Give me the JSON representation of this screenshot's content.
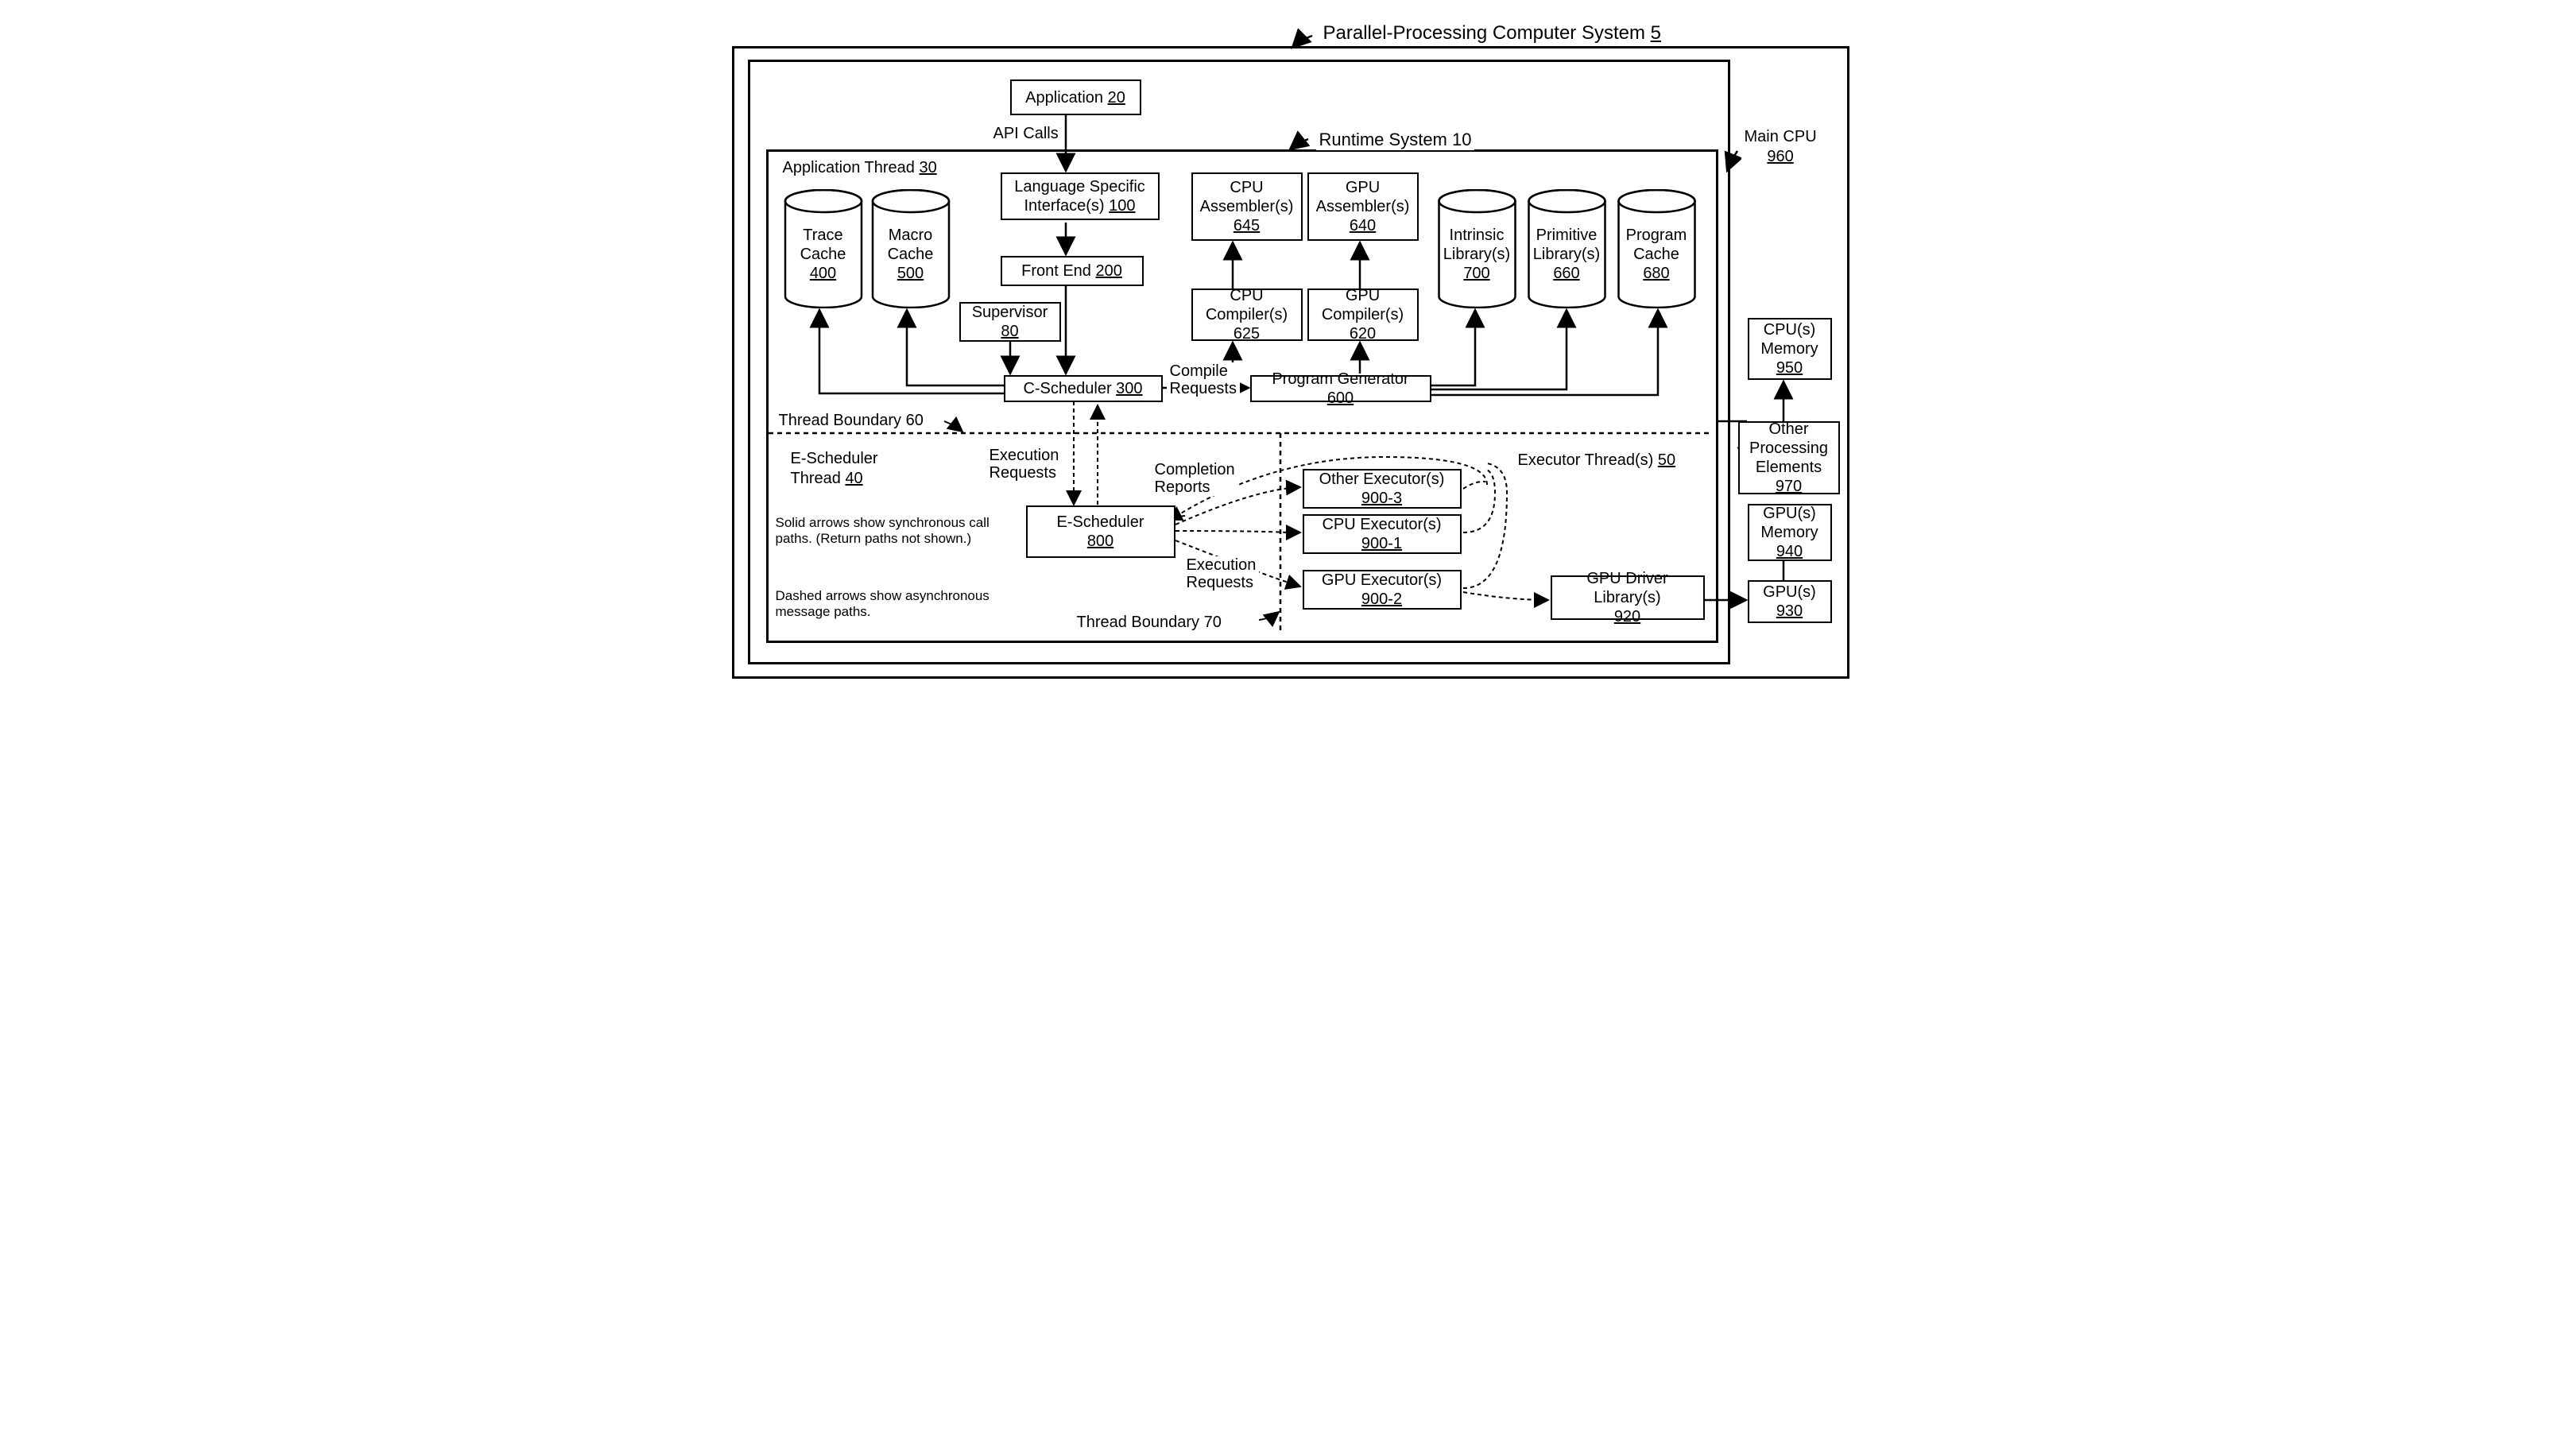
{
  "title": "Parallel-Processing Computer System",
  "title_ref": "5",
  "main_cpu": "Main CPU",
  "main_cpu_ref": "960",
  "runtime": "Runtime System 10",
  "app_thread": "Application Thread",
  "app_thread_ref": "30",
  "app": "Application",
  "app_ref": "20",
  "api_calls": "API Calls",
  "lsi": "Language Specific Interface(s)",
  "lsi_ref": "100",
  "frontend": "Front End",
  "frontend_ref": "200",
  "supervisor": "Supervisor",
  "supervisor_ref": "80",
  "csched": "C-Scheduler",
  "csched_ref": "300",
  "cpu_asm": "CPU Assembler(s)",
  "cpu_asm_ref": "645",
  "gpu_asm": "GPU Assembler(s)",
  "gpu_asm_ref": "640",
  "cpu_comp": "CPU Compiler(s)",
  "cpu_comp_ref": "625",
  "gpu_comp": "GPU Compiler(s)",
  "gpu_comp_ref": "620",
  "pgen": "Program Generator",
  "pgen_ref": "600",
  "trace": "Trace Cache",
  "trace_ref": "400",
  "macro": "Macro Cache",
  "macro_ref": "500",
  "intr": "Intrinsic Library(s)",
  "intr_ref": "700",
  "prim": "Primitive Library(s)",
  "prim_ref": "660",
  "pcache": "Program Cache",
  "pcache_ref": "680",
  "compile_req": "Compile Requests",
  "thread60": "Thread Boundary 60",
  "thread70": "Thread Boundary 70",
  "esched_thread": "E-Scheduler Thread",
  "esched_thread_ref": "40",
  "exec_req": "Execution Requests",
  "comp_rep": "Completion Reports",
  "esched": "E-Scheduler",
  "esched_ref": "800",
  "other_exec": "Other Executor(s)",
  "other_exec_ref": "900-3",
  "cpu_exec": "CPU Executor(s)",
  "cpu_exec_ref": "900-1",
  "gpu_exec": "GPU Executor(s)",
  "gpu_exec_ref": "900-2",
  "exec_threads": "Executor Thread(s)",
  "exec_threads_ref": "50",
  "gpu_driver": "GPU Driver Library(s)",
  "gpu_driver_ref": "920",
  "cpus_mem": "CPU(s) Memory",
  "cpus_mem_ref": "950",
  "other_pe": "Other Processing Elements",
  "other_pe_ref": "970",
  "gpus_mem": "GPU(s) Memory",
  "gpus_mem_ref": "940",
  "gpus": "GPU(s)",
  "gpus_ref": "930",
  "note1": "Solid arrows show synchronous call paths.  (Return paths not shown.)",
  "note2": "Dashed arrows show asynchronous message paths."
}
